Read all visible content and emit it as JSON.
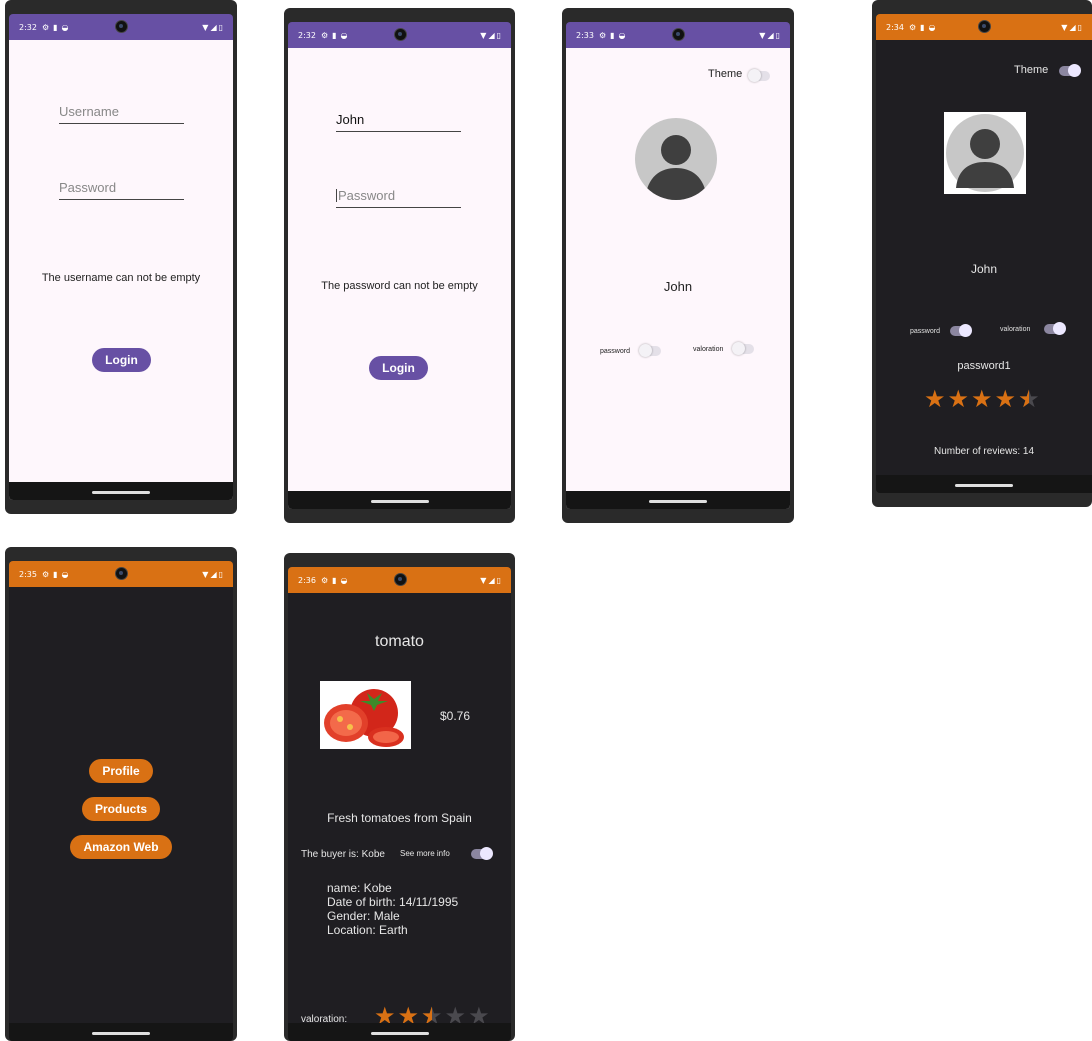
{
  "colors": {
    "purple": "#6750a4",
    "orange": "#d97114",
    "dark_bg": "#1f1e22",
    "light_bg": "#fef7fc",
    "star": "#d97114"
  },
  "screen1": {
    "time": "2:32",
    "username_placeholder": "Username",
    "password_placeholder": "Password",
    "error": "The username can not be empty",
    "login": "Login"
  },
  "screen2": {
    "time": "2:32",
    "username_value": "John",
    "password_placeholder": "Password",
    "error": "The password can not be empty",
    "login": "Login"
  },
  "screen3": {
    "time": "2:33",
    "theme_label": "Theme",
    "theme_on": false,
    "name": "John",
    "password_label": "password",
    "password_on": false,
    "valoration_label": "valoration",
    "valoration_on": false
  },
  "screen4": {
    "time": "2:34",
    "theme_label": "Theme",
    "theme_on": true,
    "name": "John",
    "password_label": "password",
    "password_on": true,
    "valoration_label": "valoration",
    "valoration_on": true,
    "password_value": "password1",
    "rating": 4.5,
    "reviews": "Number of reviews: 14"
  },
  "screen5": {
    "time": "2:35",
    "buttons": [
      "Profile",
      "Products",
      "Amazon Web"
    ]
  },
  "screen6": {
    "time": "2:36",
    "product_name": "tomato",
    "price": "$0.76",
    "description": "Fresh tomatoes from Spain",
    "buyer": "The buyer is: Kobe",
    "see_more": "See more info",
    "see_more_on": true,
    "buyer_details": [
      "name: Kobe",
      "Date of birth: 14/11/1995",
      "Gender: Male",
      "Location: Earth"
    ],
    "valoration_label": "valoration:",
    "rating": 2.5
  }
}
